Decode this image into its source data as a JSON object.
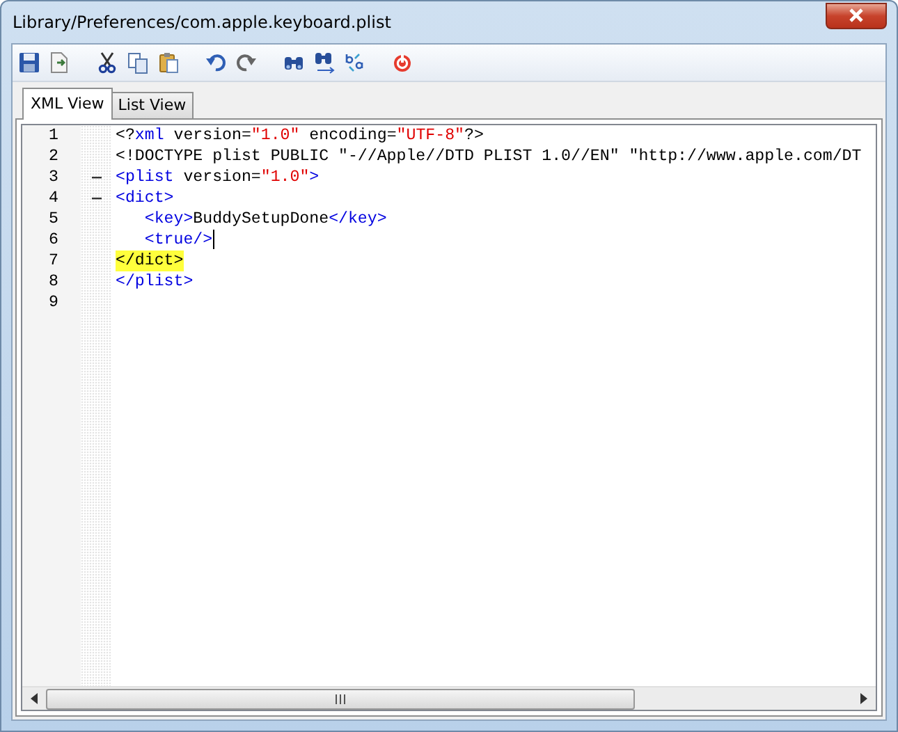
{
  "window": {
    "title": "Library/Preferences/com.apple.keyboard.plist"
  },
  "toolbar": [
    {
      "kind": "save"
    },
    {
      "kind": "export"
    },
    {
      "kind": "sep"
    },
    {
      "kind": "cut"
    },
    {
      "kind": "copy"
    },
    {
      "kind": "paste"
    },
    {
      "kind": "sep"
    },
    {
      "kind": "undo"
    },
    {
      "kind": "redo"
    },
    {
      "kind": "sep"
    },
    {
      "kind": "find"
    },
    {
      "kind": "findnext"
    },
    {
      "kind": "replace"
    },
    {
      "kind": "sep"
    },
    {
      "kind": "power"
    }
  ],
  "tabs": [
    {
      "label": "XML View",
      "selected": true
    },
    {
      "label": "List View",
      "selected": false
    }
  ],
  "editor": {
    "lines": [
      {
        "number": "1",
        "fold": false,
        "highlighted": false,
        "caret": false,
        "indented": false,
        "tokens": [
          {
            "kind": "plain",
            "text": "<?"
          },
          {
            "kind": "tag",
            "text": "xml"
          },
          {
            "kind": "plain",
            "text": " version="
          },
          {
            "kind": "string",
            "text": "\"1.0\""
          },
          {
            "kind": "plain",
            "text": " encoding="
          },
          {
            "kind": "string",
            "text": "\"UTF-8\""
          },
          {
            "kind": "plain",
            "text": "?>"
          }
        ]
      },
      {
        "number": "2",
        "fold": false,
        "highlighted": false,
        "caret": false,
        "indented": false,
        "tokens": [
          {
            "kind": "plain",
            "text": "<!DOCTYPE plist PUBLIC \"-//Apple//DTD PLIST 1.0//EN\" \"http://www.apple.com/DT"
          }
        ]
      },
      {
        "number": "3",
        "fold": true,
        "highlighted": false,
        "caret": false,
        "indented": false,
        "tokens": [
          {
            "kind": "tag",
            "text": "<plist"
          },
          {
            "kind": "plain",
            "text": " version="
          },
          {
            "kind": "string",
            "text": "\"1.0\""
          },
          {
            "kind": "tag",
            "text": ">"
          }
        ]
      },
      {
        "number": "4",
        "fold": true,
        "highlighted": false,
        "caret": false,
        "indented": false,
        "tokens": [
          {
            "kind": "tag",
            "text": "<dict>"
          }
        ]
      },
      {
        "number": "5",
        "fold": false,
        "highlighted": false,
        "caret": false,
        "indented": true,
        "tokens": [
          {
            "kind": "tag",
            "text": "<key>"
          },
          {
            "kind": "plain",
            "text": "BuddySetupDone"
          },
          {
            "kind": "tag",
            "text": "</key>"
          }
        ]
      },
      {
        "number": "6",
        "fold": false,
        "highlighted": false,
        "caret": true,
        "indented": true,
        "tokens": [
          {
            "kind": "tag",
            "text": "<true/>"
          }
        ]
      },
      {
        "number": "7",
        "fold": false,
        "highlighted": true,
        "caret": false,
        "indented": false,
        "tokens": [
          {
            "kind": "plain",
            "text": "</dict>"
          }
        ]
      },
      {
        "number": "8",
        "fold": false,
        "highlighted": false,
        "caret": false,
        "indented": false,
        "tokens": [
          {
            "kind": "tag",
            "text": "</plist>"
          }
        ]
      },
      {
        "number": "9",
        "fold": false,
        "caret": false
      }
    ]
  }
}
